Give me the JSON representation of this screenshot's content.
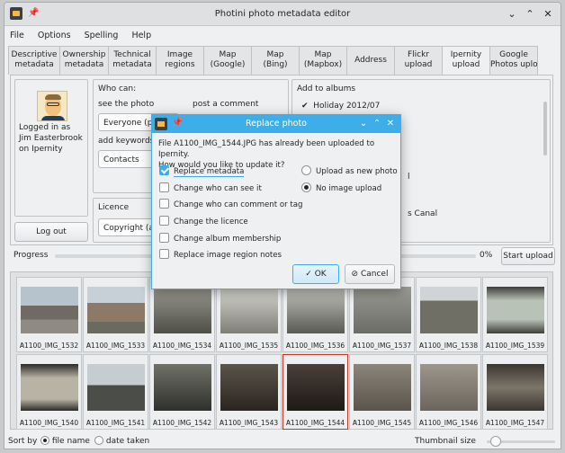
{
  "window": {
    "title": "Photini photo metadata editor"
  },
  "menu": [
    "File",
    "Options",
    "Spelling",
    "Help"
  ],
  "tabs": [
    {
      "l1": "Descriptive",
      "l2": "metadata"
    },
    {
      "l1": "Ownership",
      "l2": "metadata"
    },
    {
      "l1": "Technical",
      "l2": "metadata"
    },
    {
      "l1": "Image",
      "l2": "regions"
    },
    {
      "l1": "Map",
      "l2": "(Google)"
    },
    {
      "l1": "Map",
      "l2": "(Bing)"
    },
    {
      "l1": "Map",
      "l2": "(Mapbox)"
    },
    {
      "l1": "Address",
      "l2": ""
    },
    {
      "l1": "Flickr",
      "l2": "upload"
    },
    {
      "l1": "Ipernity",
      "l2": "upload"
    },
    {
      "l1": "Google",
      "l2": "Photos uplo"
    }
  ],
  "ipernity": {
    "user_l1": "Logged in as",
    "user_l2": "Jim Easterbrook",
    "user_l3": "on Ipernity",
    "logout": "Log out",
    "who_can_title": "Who can:",
    "see_photo": "see the photo",
    "post_comment": "post a comment",
    "see_value": "Everyone (publ",
    "add_keywords": "add keywords, n",
    "keywords_value": "Contacts",
    "licence_title": "Licence",
    "licence_value": "Copyright (all r",
    "albums_title": "Add to albums",
    "album_1": "Holiday 2012/07",
    "album_frag_1": "l",
    "album_frag_2": "s Canal"
  },
  "progress": {
    "label": "Progress",
    "percent": "0%",
    "start": "Start upload",
    "value": 0
  },
  "thumbnails": [
    "A1100_IMG_1532",
    "A1100_IMG_1533",
    "A1100_IMG_1534",
    "A1100_IMG_1535",
    "A1100_IMG_1536",
    "A1100_IMG_1537",
    "A1100_IMG_1538",
    "A1100_IMG_1539",
    "A1100_IMG_1540",
    "A1100_IMG_1541",
    "A1100_IMG_1542",
    "A1100_IMG_1543",
    "A1100_IMG_1544",
    "A1100_IMG_1545",
    "A1100_IMG_1546",
    "A1100_IMG_1547"
  ],
  "status": {
    "sort_by": "Sort by",
    "file_name": "file name",
    "date_taken": "date taken",
    "thumb_size": "Thumbnail size"
  },
  "dialog": {
    "title": "Replace photo",
    "message_l1": "File A1100_IMG_1544.JPG has already been uploaded to Ipernity.",
    "message_l2": "How would you like to update it?",
    "replace_metadata": "Replace metadata",
    "change_who": "Change who can see it",
    "change_comment": "Change who can comment or tag",
    "change_licence": "Change the licence",
    "change_album": "Change album membership",
    "replace_regions": "Replace image region notes",
    "upload_new": "Upload as new photo",
    "no_upload": "No image upload",
    "ok": "OK",
    "cancel": "Cancel"
  },
  "colors": {
    "accent": "#3daee9",
    "selection": "#c0392b"
  }
}
